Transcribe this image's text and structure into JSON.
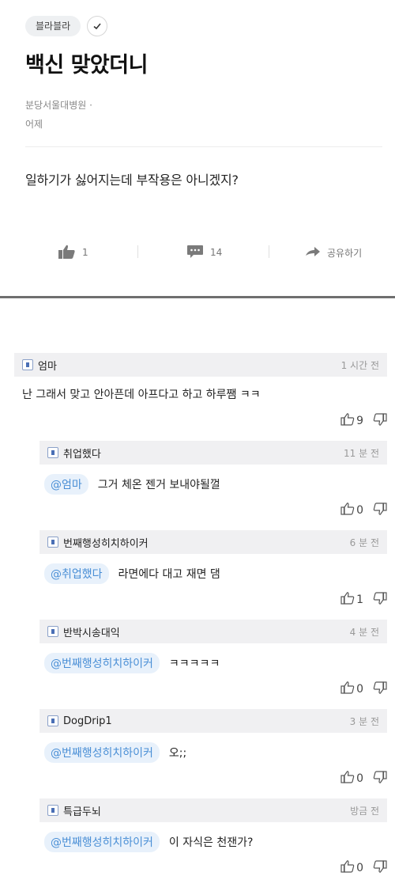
{
  "post": {
    "category": "블라블라",
    "title": "백신 맞았더니",
    "author": "분당서울대병원 ·",
    "date": "어제",
    "body": "일하기가 싫어지는데 부작용은 아니겠지?",
    "like_count": "1",
    "comment_count": "14",
    "share_label": "공유하기"
  },
  "comments": [
    {
      "name": "엄마",
      "time": "1 시간 전",
      "mention": "",
      "text": "난 그래서 맞고 안아픈데 아프다고 하고 하루쨈 ㅋㅋ",
      "likes": "9"
    },
    {
      "name": "취업했다",
      "time": "11 분 전",
      "mention": "@엄마",
      "text": "그거 체온 젠거 보내야될껄",
      "likes": "0"
    },
    {
      "name": "번째행성히치하이커",
      "time": "6 분 전",
      "mention": "@취업했다",
      "text": "라면에다 대고 재면 댐",
      "likes": "1"
    },
    {
      "name": "반박시송대익",
      "time": "4 분 전",
      "mention": "@번째행성히치하이커",
      "text": "ㅋㅋㅋㅋㅋ",
      "likes": "0"
    },
    {
      "name": "DogDrip1",
      "time": "3 분 전",
      "mention": "@번째행성히치하이커",
      "text": "오;;",
      "likes": "0"
    },
    {
      "name": "특급두뇌",
      "time": "방금 전",
      "mention": "@번째행성히치하이커",
      "text": "이 자식은 천잰가?",
      "likes": "0"
    }
  ],
  "icons": {
    "check": "check-icon",
    "like": "thumbs-up-icon",
    "comment": "speech-bubble-icon",
    "share": "share-arrow-icon",
    "vote_up": "thumbs-up-outline-icon",
    "vote_down": "thumbs-down-outline-icon"
  },
  "colors": {
    "mention_text": "#4a8fd6",
    "mention_bg": "#e8f1fb",
    "comment_header_bg": "#f0f0f2"
  }
}
